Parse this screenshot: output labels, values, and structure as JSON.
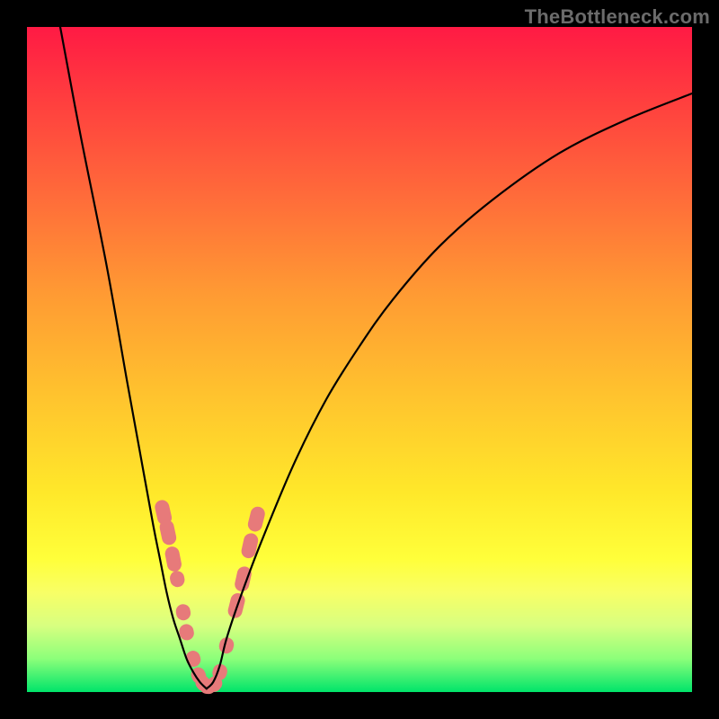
{
  "watermark": "TheBottleneck.com",
  "colors": {
    "frame_bg_top": "#ff1a44",
    "frame_bg_bottom": "#00e46a",
    "curve": "#000000",
    "markers": "#e77a7a",
    "page_bg": "#000000",
    "watermark": "#6b6b6b"
  },
  "chart_data": {
    "type": "line",
    "title": "",
    "xlabel": "",
    "ylabel": "",
    "xlim": [
      0,
      100
    ],
    "ylim": [
      0,
      100
    ],
    "grid": false,
    "legend": false,
    "series": [
      {
        "name": "left-branch",
        "x": [
          5,
          8,
          12,
          15,
          17,
          19,
          20,
          21,
          22,
          23,
          24,
          25,
          26,
          27
        ],
        "y": [
          100,
          84,
          64,
          47,
          36,
          25,
          20,
          15,
          11,
          8,
          5,
          3,
          1.5,
          0.5
        ]
      },
      {
        "name": "right-branch",
        "x": [
          27,
          28,
          29,
          30,
          32,
          35,
          40,
          45,
          50,
          55,
          62,
          70,
          80,
          90,
          100
        ],
        "y": [
          0.5,
          1.5,
          4,
          8,
          14,
          22,
          34,
          44,
          52,
          59,
          67,
          74,
          81,
          86,
          90
        ]
      }
    ],
    "markers": {
      "name": "highlight-dots",
      "color": "#e77a7a",
      "points": [
        {
          "x": 20.5,
          "y": 27
        },
        {
          "x": 21.2,
          "y": 24
        },
        {
          "x": 22.0,
          "y": 20
        },
        {
          "x": 22.6,
          "y": 17
        },
        {
          "x": 23.5,
          "y": 12
        },
        {
          "x": 24.0,
          "y": 9
        },
        {
          "x": 25.0,
          "y": 5
        },
        {
          "x": 25.8,
          "y": 2.5
        },
        {
          "x": 26.5,
          "y": 1.3
        },
        {
          "x": 27.2,
          "y": 0.8
        },
        {
          "x": 28.2,
          "y": 1.2
        },
        {
          "x": 29.0,
          "y": 3
        },
        {
          "x": 30.0,
          "y": 7
        },
        {
          "x": 31.5,
          "y": 13
        },
        {
          "x": 32.5,
          "y": 17
        },
        {
          "x": 33.5,
          "y": 22
        },
        {
          "x": 34.5,
          "y": 26
        }
      ]
    }
  }
}
